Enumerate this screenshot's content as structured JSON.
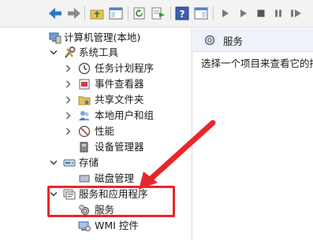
{
  "toolbar": {
    "buttons": [
      {
        "name": "back-icon"
      },
      {
        "name": "forward-icon"
      },
      {
        "name": "up-folder-icon"
      },
      {
        "name": "show-hide-tree-icon"
      },
      {
        "name": "refresh-icon"
      },
      {
        "name": "export-list-icon"
      },
      {
        "name": "help-icon"
      },
      {
        "name": "show-action-pane-icon"
      },
      {
        "name": "start-service-icon"
      },
      {
        "name": "start-service-alt-icon"
      },
      {
        "name": "stop-service-icon"
      },
      {
        "name": "pause-service-icon"
      },
      {
        "name": "restart-service-icon"
      }
    ]
  },
  "tree": {
    "root": "计算机管理(本地)",
    "system_tools": "系统工具",
    "task_scheduler": "任务计划程序",
    "event_viewer": "事件查看器",
    "shared_folders": "共享文件夹",
    "local_users": "本地用户和组",
    "performance": "性能",
    "device_manager": "设备管理器",
    "storage": "存储",
    "disk_management": "磁盘管理",
    "services_apps": "服务和应用程序",
    "services": "服务",
    "wmi": "WMI 控件"
  },
  "right_pane": {
    "title": "服务",
    "description": "选择一个项目来查看它的描"
  },
  "annotation": {
    "box_color": "#e8262a",
    "arrow_color": "#e8262a"
  }
}
